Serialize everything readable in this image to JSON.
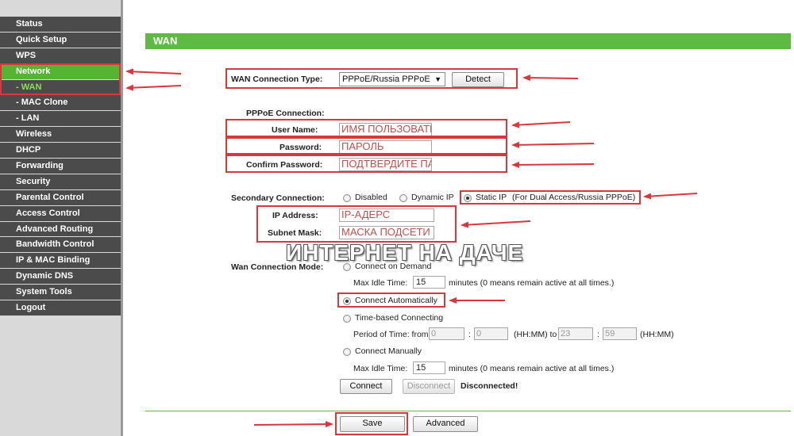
{
  "sidebar": {
    "items": [
      {
        "label": "Status"
      },
      {
        "label": "Quick Setup"
      },
      {
        "label": "WPS"
      },
      {
        "label": "Network"
      },
      {
        "label": "- WAN"
      },
      {
        "label": "- MAC Clone"
      },
      {
        "label": "- LAN"
      },
      {
        "label": "Wireless"
      },
      {
        "label": "DHCP"
      },
      {
        "label": "Forwarding"
      },
      {
        "label": "Security"
      },
      {
        "label": "Parental Control"
      },
      {
        "label": "Access Control"
      },
      {
        "label": "Advanced Routing"
      },
      {
        "label": "Bandwidth Control"
      },
      {
        "label": "IP & MAC Binding"
      },
      {
        "label": "Dynamic DNS"
      },
      {
        "label": "System Tools"
      },
      {
        "label": "Logout"
      }
    ]
  },
  "header": {
    "title": "WAN"
  },
  "wan_type": {
    "label": "WAN Connection Type:",
    "selected": "PPPoE/Russia PPPoE",
    "detect_label": "Detect"
  },
  "pppoe": {
    "section_label": "PPPoE Connection:",
    "username_label": "User Name:",
    "username_value": "ИМЯ ПОЛЬЗОВАТЕЛЯ",
    "password_label": "Password:",
    "password_value": "ПАРОЛЬ",
    "confirm_label": "Confirm Password:",
    "confirm_value": "ПОДТВЕРДИТЕ ПАРОЛЬ"
  },
  "secondary": {
    "label": "Secondary Connection:",
    "opt_disabled": "Disabled",
    "opt_dynamic": "Dynamic IP",
    "opt_static": "Static IP",
    "opt_static_note": "(For Dual Access/Russia PPPoE)",
    "ip_label": "IP Address:",
    "ip_value": "IP-АДЕРС",
    "mask_label": "Subnet Mask:",
    "mask_value": "МАСКА ПОДСЕТИ"
  },
  "watermark": "ИНТЕРНЕТ НА ДАЧЕ",
  "mode": {
    "label": "Wan Connection Mode:",
    "on_demand": "Connect on Demand",
    "max_idle_label": "Max Idle Time:",
    "max_idle_value_1": "15",
    "max_idle_note": "minutes (0 means remain active at all times.)",
    "auto": "Connect Automatically",
    "time_based": "Time-based Connecting",
    "period_label": "Period of Time: from",
    "from_h": "0",
    "from_m": "0",
    "hhmm_to": "(HH:MM) to",
    "to_h": "23",
    "to_m": "59",
    "hhmm": "(HH:MM)",
    "colon": ":",
    "manual": "Connect Manually",
    "max_idle_value_2": "15"
  },
  "actions": {
    "connect": "Connect",
    "disconnect": "Disconnect",
    "status": "Disconnected!",
    "save": "Save",
    "advanced": "Advanced"
  },
  "colors": {
    "accent_green": "#5eba42",
    "annotation_red": "#d9363e",
    "menu_dark": "#4b4b4b"
  }
}
